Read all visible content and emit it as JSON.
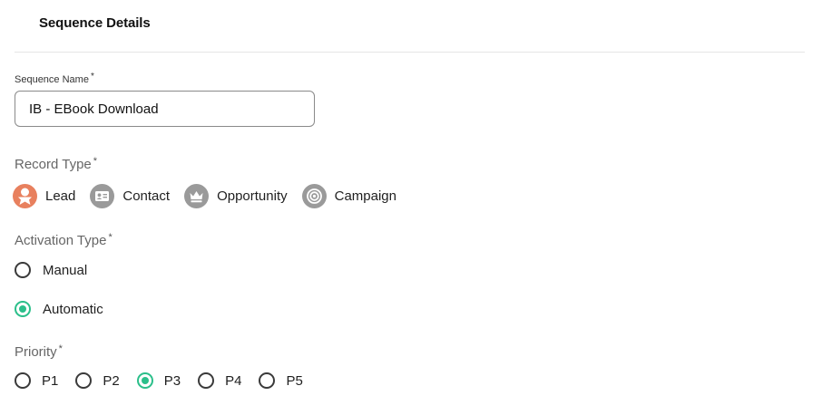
{
  "section": {
    "title": "Sequence Details"
  },
  "sequence_name": {
    "label": "Sequence Name",
    "required_mark": "*",
    "value": "IB - EBook Download"
  },
  "record_type": {
    "label": "Record Type",
    "required_mark": "*",
    "selected": "Lead",
    "options": [
      {
        "label": "Lead",
        "icon": "lead-icon",
        "active": true
      },
      {
        "label": "Contact",
        "icon": "contact-card-icon",
        "active": false
      },
      {
        "label": "Opportunity",
        "icon": "crown-icon",
        "active": false
      },
      {
        "label": "Campaign",
        "icon": "target-icon",
        "active": false
      }
    ]
  },
  "activation_type": {
    "label": "Activation Type",
    "required_mark": "*",
    "selected": "Automatic",
    "options": [
      {
        "label": "Manual",
        "checked": false
      },
      {
        "label": "Automatic",
        "checked": true
      }
    ]
  },
  "priority": {
    "label": "Priority",
    "required_mark": "*",
    "selected": "P3",
    "options": [
      {
        "label": "P1",
        "checked": false
      },
      {
        "label": "P2",
        "checked": false
      },
      {
        "label": "P3",
        "checked": true
      },
      {
        "label": "P4",
        "checked": false
      },
      {
        "label": "P5",
        "checked": false
      }
    ]
  },
  "colors": {
    "accent_green": "#2bbf8a",
    "lead_orange": "#e8805e",
    "icon_gray": "#9a9a9a"
  }
}
